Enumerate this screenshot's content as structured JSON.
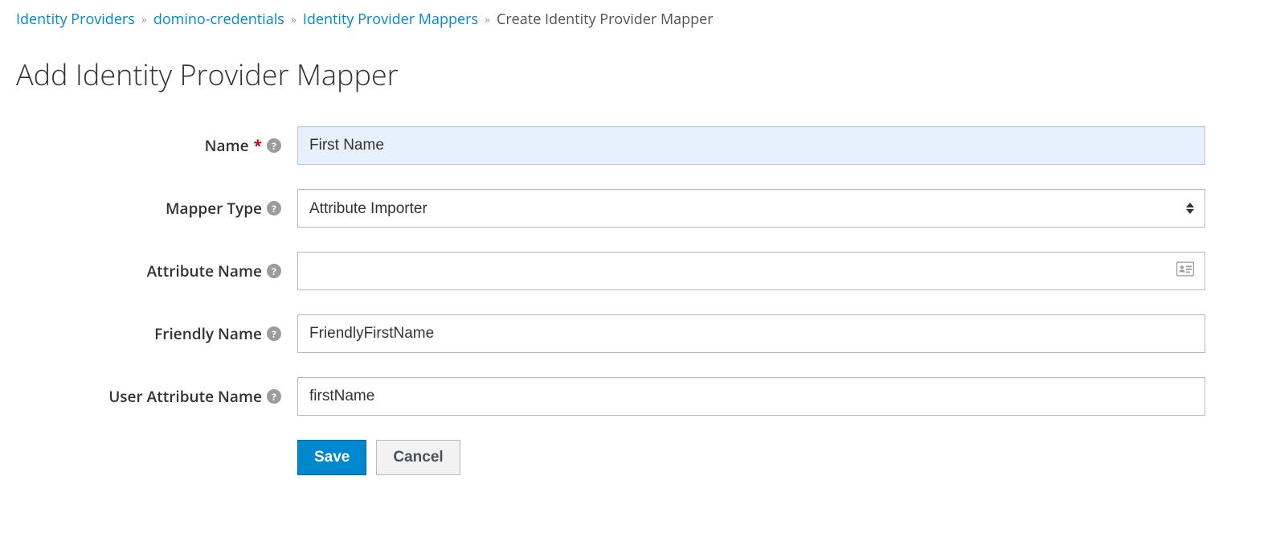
{
  "breadcrumb": {
    "items": [
      {
        "label": "Identity Providers",
        "link": true
      },
      {
        "label": "domino-credentials",
        "link": true
      },
      {
        "label": "Identity Provider Mappers",
        "link": true
      },
      {
        "label": "Create Identity Provider Mapper",
        "link": false
      }
    ]
  },
  "page": {
    "title": "Add Identity Provider Mapper"
  },
  "form": {
    "name": {
      "label": "Name",
      "required": true,
      "value": "First Name"
    },
    "mapper_type": {
      "label": "Mapper Type",
      "value": "Attribute Importer"
    },
    "attribute_name": {
      "label": "Attribute Name",
      "value": ""
    },
    "friendly_name": {
      "label": "Friendly Name",
      "value": "FriendlyFirstName"
    },
    "user_attribute_name": {
      "label": "User Attribute Name",
      "value": "firstName"
    }
  },
  "buttons": {
    "save": "Save",
    "cancel": "Cancel"
  }
}
